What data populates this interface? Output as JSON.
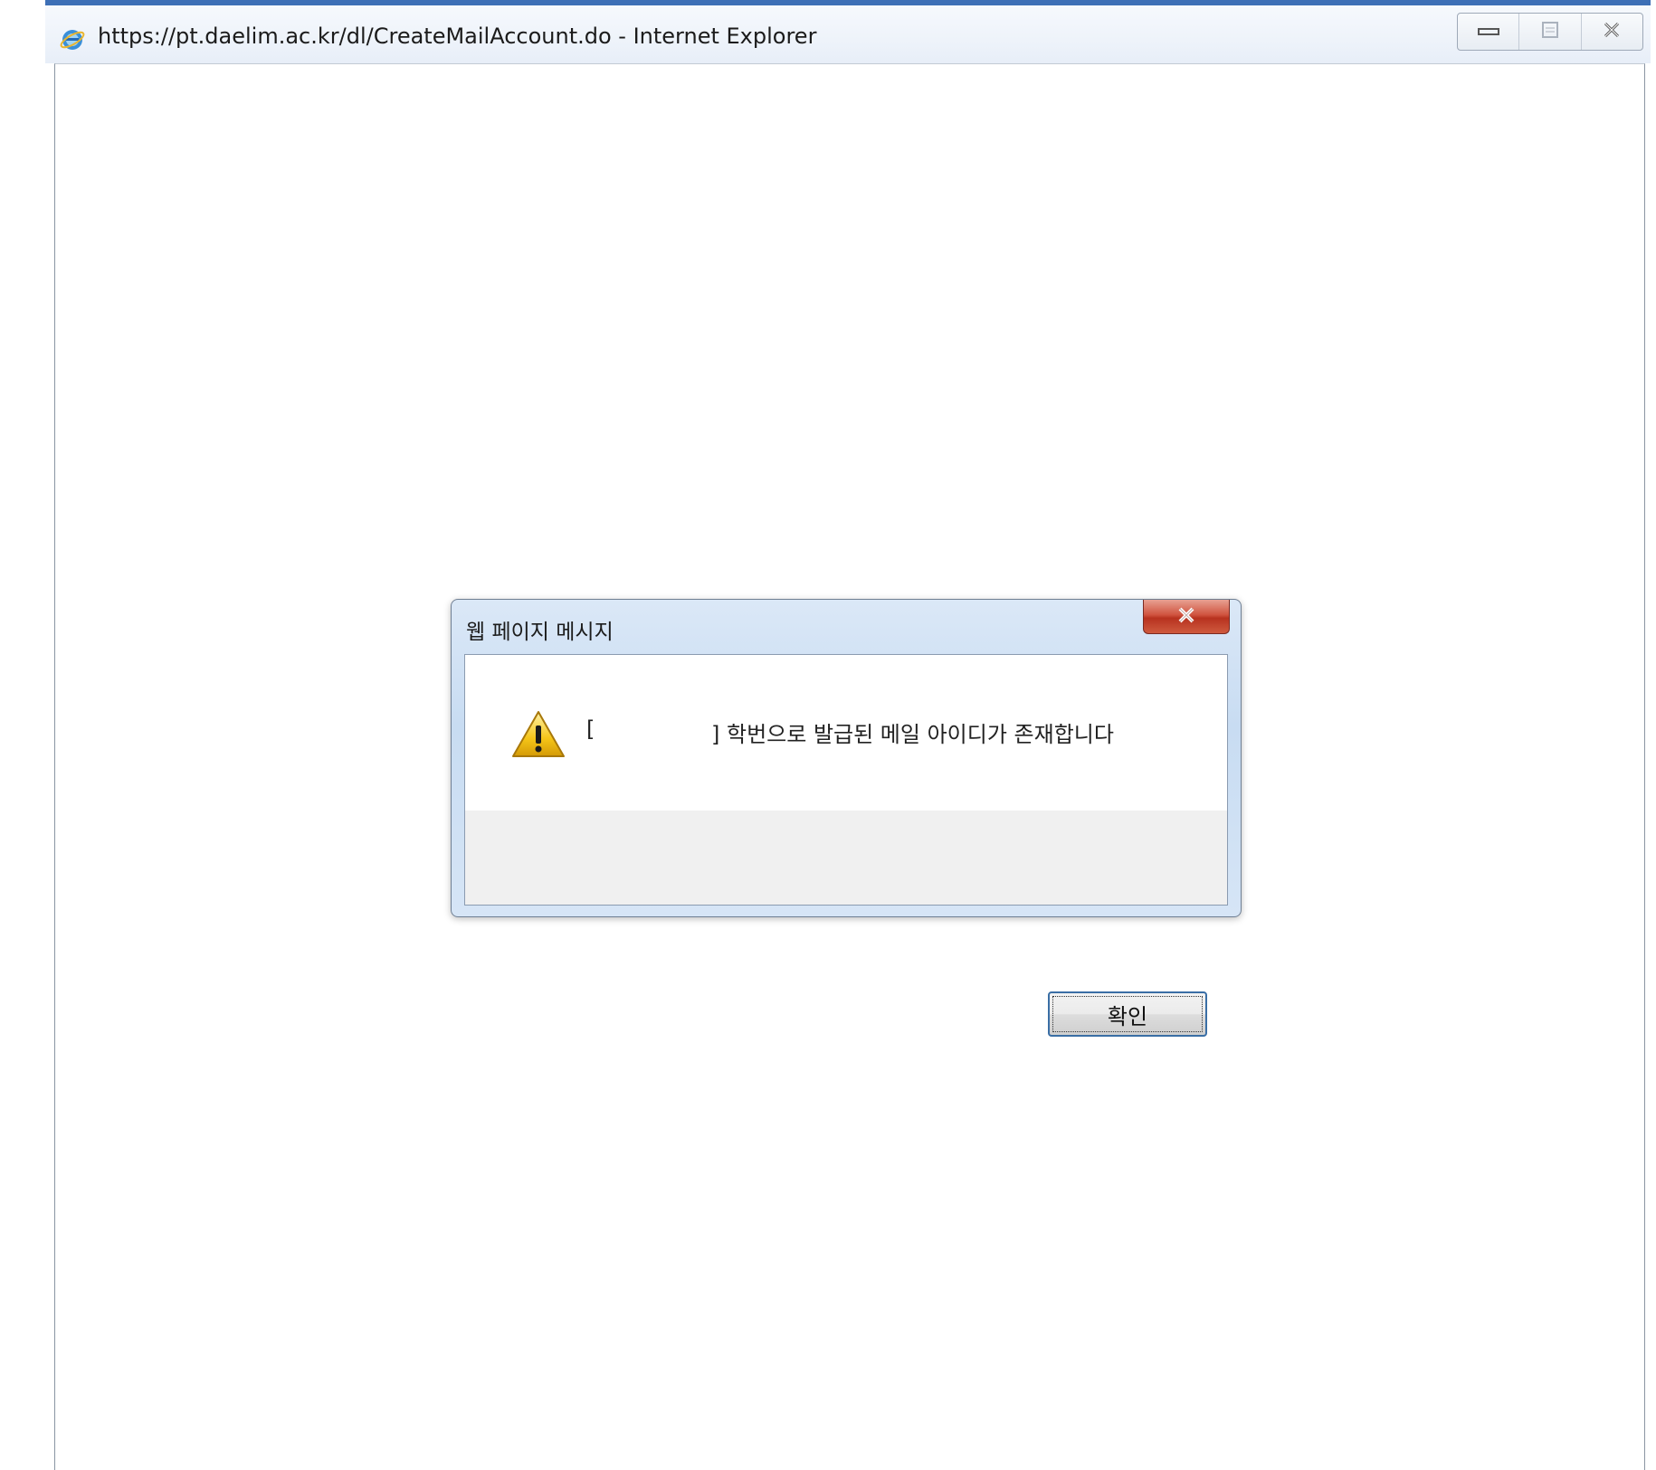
{
  "window": {
    "title": "https://pt.daelim.ac.kr/dl/CreateMailAccount.do - Internet Explorer",
    "icon": "internet-explorer-icon",
    "caption_buttons": [
      "minimize-icon",
      "maximize-icon",
      "close-icon"
    ]
  },
  "dialog": {
    "title": "웹 페이지 메시지",
    "icon": "warning-icon",
    "message_bracket_open": "[",
    "message_text": "] 학번으로 발급된 메일 아이디가 존재합니다",
    "ok_label": "확인"
  },
  "colors": {
    "window_border": "#3d6fb6",
    "dialog_close": "#c9432d",
    "ok_focus": "#3a6ea5"
  }
}
